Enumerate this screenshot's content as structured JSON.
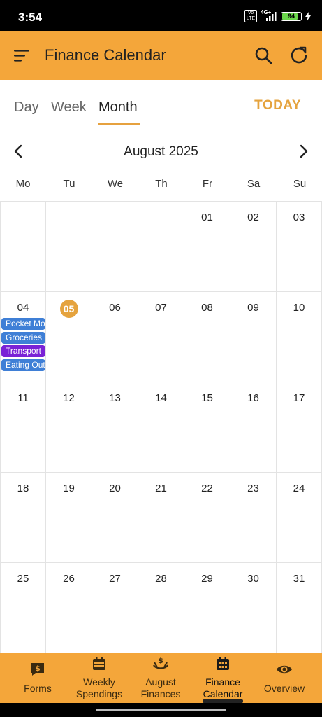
{
  "status": {
    "time": "3:54",
    "net": "4G+",
    "volte": "Vo LTE",
    "battery": "94"
  },
  "appbar": {
    "title": "Finance Calendar"
  },
  "tabs": [
    {
      "label": "Day"
    },
    {
      "label": "Week"
    },
    {
      "label": "Month"
    }
  ],
  "today_label": "TODAY",
  "month_label": "August 2025",
  "weekdays": [
    "Mo",
    "Tu",
    "We",
    "Th",
    "Fr",
    "Sa",
    "Su"
  ],
  "calendar": {
    "weeks": [
      [
        "",
        "",
        "",
        "",
        "01",
        "02",
        "03"
      ],
      [
        "04",
        "05",
        "06",
        "07",
        "08",
        "09",
        "10"
      ],
      [
        "11",
        "12",
        "13",
        "14",
        "15",
        "16",
        "17"
      ],
      [
        "18",
        "19",
        "20",
        "21",
        "22",
        "23",
        "24"
      ],
      [
        "25",
        "26",
        "27",
        "28",
        "29",
        "30",
        "31"
      ]
    ],
    "selected_day": "05",
    "events_day_04": [
      {
        "label": "Pocket Money",
        "color": "#3f7fd6"
      },
      {
        "label": "Groceries",
        "color": "#3f7fd6"
      },
      {
        "label": "Transport",
        "color": "#7a22d6"
      },
      {
        "label": "Eating Out",
        "color": "#3f7fd6"
      }
    ]
  },
  "bottom_nav": [
    {
      "line1": "Forms",
      "line2": "",
      "icon": "dollar-note-icon"
    },
    {
      "line1": "Weekly",
      "line2": "Spendings",
      "icon": "calendar-week-icon"
    },
    {
      "line1": "August",
      "line2": "Finances",
      "icon": "hand-dollar-icon"
    },
    {
      "line1": "Finance",
      "line2": "Calendar",
      "icon": "calendar-month-icon"
    },
    {
      "line1": "Overview",
      "line2": "",
      "icon": "eye-icon"
    }
  ],
  "colors": {
    "accent": "#f4a63a",
    "today": "#e5a33e"
  }
}
